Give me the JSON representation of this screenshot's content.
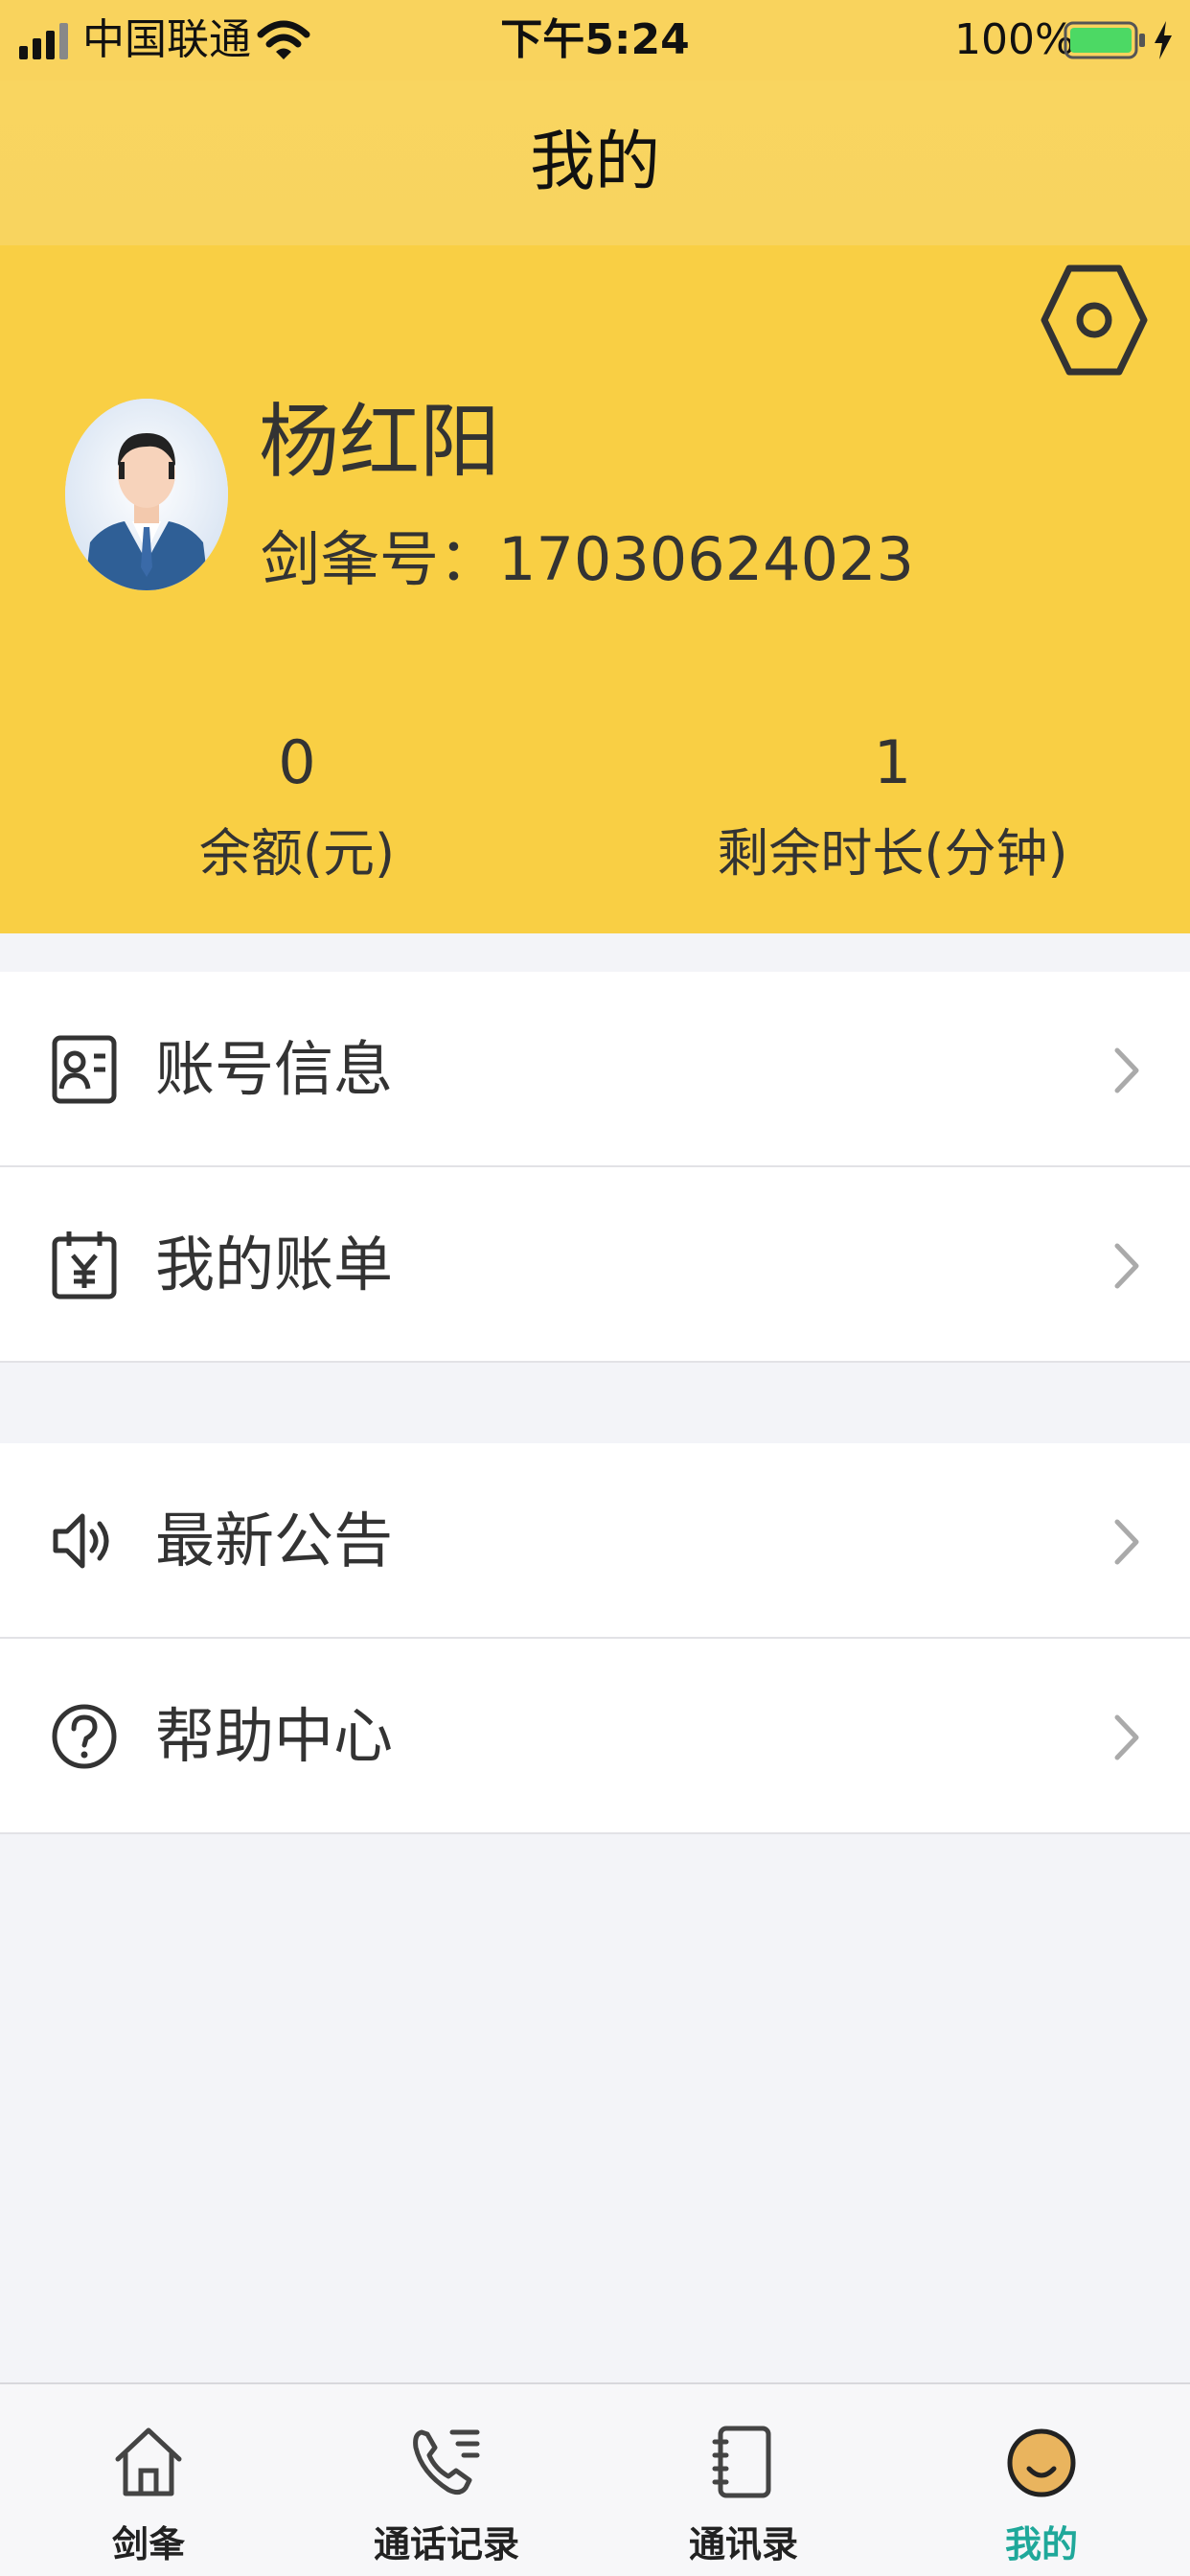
{
  "status_bar": {
    "carrier": "中国联通",
    "time": "下午5:24",
    "battery": "100%"
  },
  "header": {
    "title": "我的"
  },
  "profile": {
    "name": "杨红阳",
    "id_label": "剑夆号：",
    "id_value": "17030624023",
    "stats": [
      {
        "value": "0",
        "label": "余额(元)"
      },
      {
        "value": "1",
        "label": "剩余时长(分钟)"
      }
    ]
  },
  "menu": {
    "group1": [
      {
        "label": "账号信息",
        "icon": "id-card-icon"
      },
      {
        "label": "我的账单",
        "icon": "bill-icon"
      }
    ],
    "group2": [
      {
        "label": "最新公告",
        "icon": "speaker-icon"
      },
      {
        "label": "帮助中心",
        "icon": "help-icon"
      }
    ]
  },
  "tabs": [
    {
      "label": "剑夆",
      "icon": "home-icon"
    },
    {
      "label": "通话记录",
      "icon": "phone-list-icon"
    },
    {
      "label": "通讯录",
      "icon": "contacts-book-icon"
    },
    {
      "label": "我的",
      "icon": "smile-face-icon",
      "active": true
    }
  ],
  "colors": {
    "header_bg": "#f9d35d",
    "profile_bg": "#f9cf44",
    "active_tab": "#1fa89a",
    "page_bg": "#f3f4f8"
  }
}
